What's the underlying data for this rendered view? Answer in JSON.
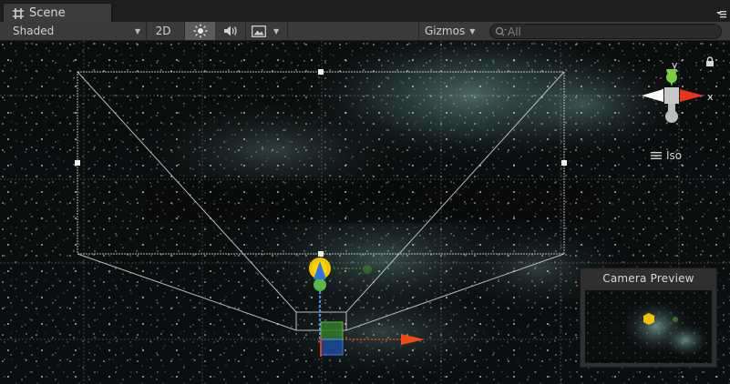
{
  "window": {
    "tab_label": "Scene"
  },
  "toolbar": {
    "draw_mode": "Shaded",
    "mode_2d": "2D",
    "lighting_toggle": "light-icon",
    "audio_toggle": "audio-icon",
    "effects_toggle": "image-icon",
    "gizmos_label": "Gizmos",
    "search_placeholder": "All"
  },
  "gizmo": {
    "axis_y": "y",
    "axis_x": "x",
    "projection": "Iso"
  },
  "camera_preview": {
    "title": "Camera Preview"
  },
  "colors": {
    "toolbar_bg": "#3a3a3a",
    "axis_x": "#e8361c",
    "axis_y": "#7ccf3d",
    "axis_z": "#3b6fd1",
    "light_gizmo": "#f2c400"
  }
}
